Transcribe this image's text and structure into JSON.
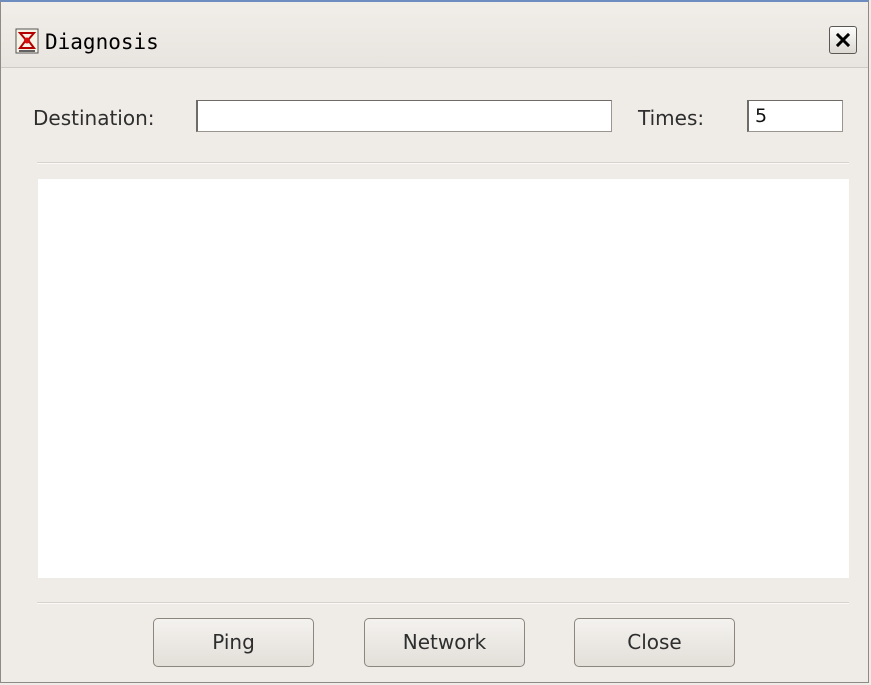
{
  "window": {
    "title": "Diagnosis",
    "icon": "app-icon",
    "close_icon": "close-icon"
  },
  "form": {
    "destination_label": "Destination:",
    "destination_value": "",
    "times_label": "Times:",
    "times_value": "5"
  },
  "output": {
    "text": ""
  },
  "buttons": {
    "ping": "Ping",
    "network": "Network",
    "close": "Close"
  },
  "colors": {
    "window_bg": "#efebe7",
    "titlebar_accent": "#6d8cc0",
    "output_bg": "#ffffff"
  }
}
